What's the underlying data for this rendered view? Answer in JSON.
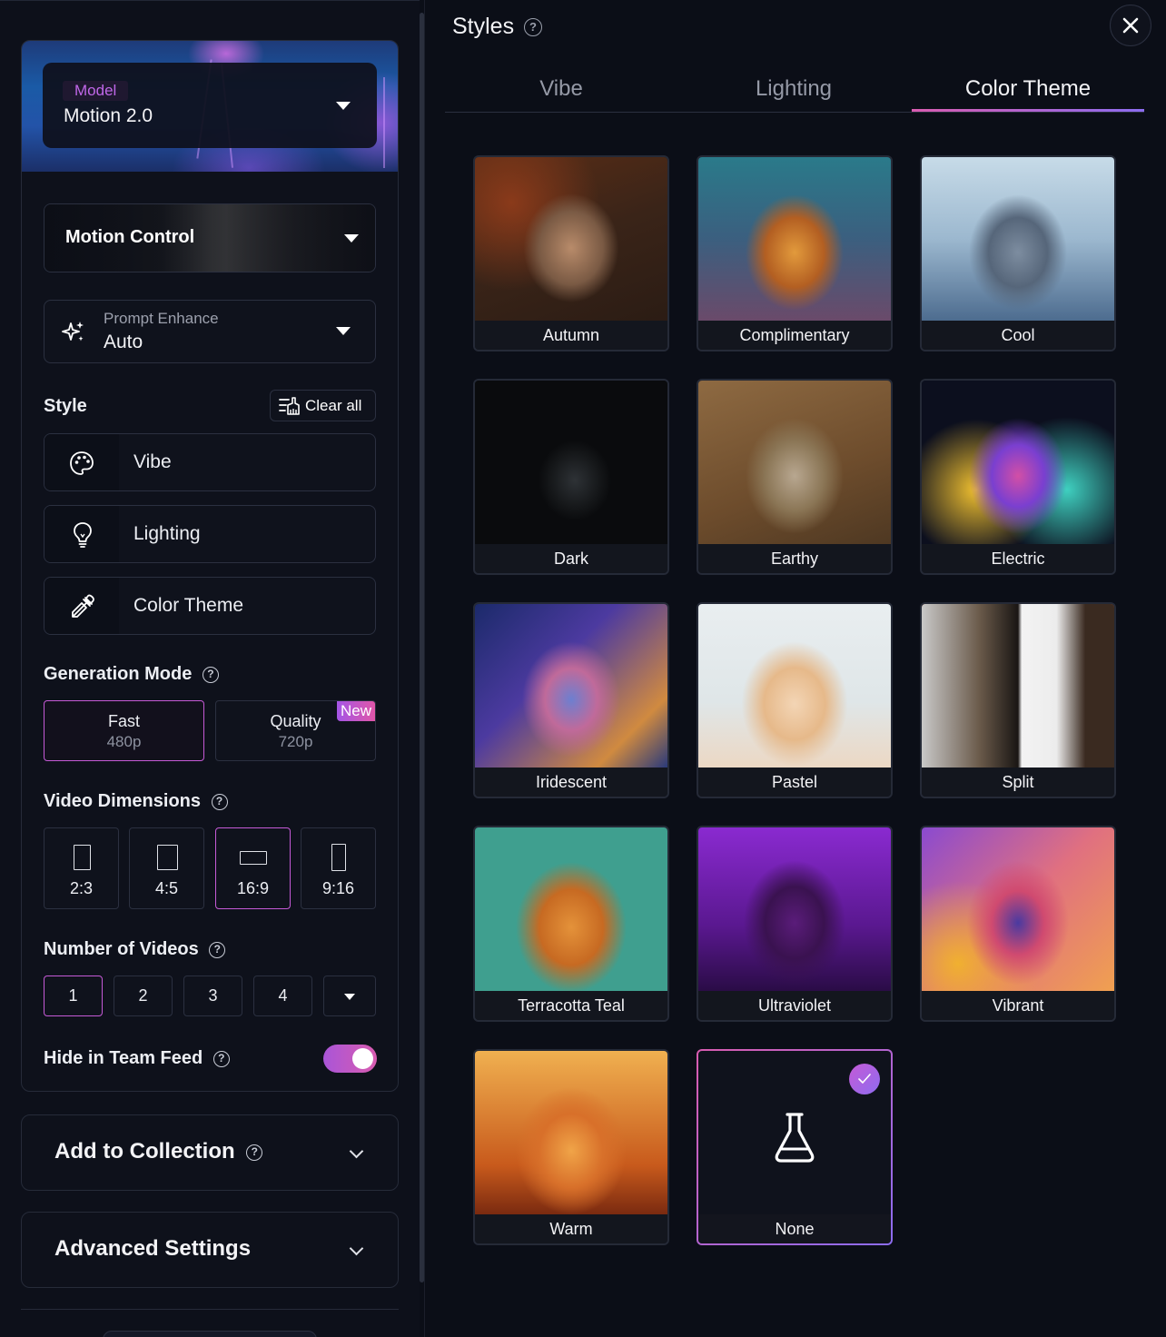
{
  "left": {
    "model": {
      "tag": "Model",
      "value": "Motion 2.0"
    },
    "motion_control": {
      "label": "Motion Control"
    },
    "prompt_enhance": {
      "label": "Prompt Enhance",
      "value": "Auto"
    },
    "style": {
      "title": "Style",
      "clear_all": "Clear all",
      "items": [
        {
          "label": "Vibe",
          "icon": "palette-icon"
        },
        {
          "label": "Lighting",
          "icon": "lightbulb-icon"
        },
        {
          "label": "Color Theme",
          "icon": "eyedropper-icon"
        }
      ]
    },
    "generation_mode": {
      "title": "Generation Mode",
      "options": [
        {
          "name": "Fast",
          "res": "480p",
          "selected": true
        },
        {
          "name": "Quality",
          "res": "720p",
          "badge": "New",
          "selected": false
        }
      ]
    },
    "video_dimensions": {
      "title": "Video Dimensions",
      "options": [
        "2:3",
        "4:5",
        "16:9",
        "9:16"
      ],
      "selected": "16:9"
    },
    "number_of_videos": {
      "title": "Number of Videos",
      "options": [
        "1",
        "2",
        "3",
        "4"
      ],
      "selected": "1"
    },
    "hide_in_team_feed": {
      "title": "Hide in Team Feed",
      "enabled": true
    },
    "add_to_collection": {
      "title": "Add to Collection"
    },
    "advanced_settings": {
      "title": "Advanced Settings"
    }
  },
  "styles_panel": {
    "title": "Styles",
    "help": "?",
    "tabs": [
      "Vibe",
      "Lighting",
      "Color Theme"
    ],
    "active_tab": "Color Theme",
    "themes": [
      {
        "label": "Autumn"
      },
      {
        "label": "Complimentary"
      },
      {
        "label": "Cool"
      },
      {
        "label": "Dark"
      },
      {
        "label": "Earthy"
      },
      {
        "label": "Electric"
      },
      {
        "label": "Iridescent"
      },
      {
        "label": "Pastel"
      },
      {
        "label": "Split"
      },
      {
        "label": "Terracotta Teal"
      },
      {
        "label": "Ultraviolet"
      },
      {
        "label": "Vibrant"
      },
      {
        "label": "Warm"
      },
      {
        "label": "None",
        "selected": true
      }
    ]
  },
  "colors": {
    "accent_pink": "#d95cb0",
    "accent_purple": "#8c6cf0",
    "background": "#0b0e17"
  }
}
